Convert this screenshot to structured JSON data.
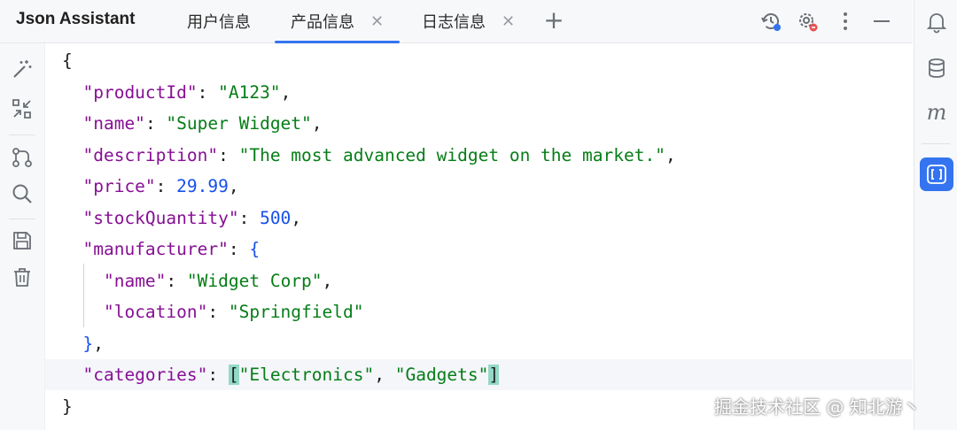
{
  "app": {
    "title": "Json Assistant"
  },
  "tabs": [
    {
      "label": "用户信息",
      "active": false,
      "closable": false
    },
    {
      "label": "产品信息",
      "active": true,
      "closable": true
    },
    {
      "label": "日志信息",
      "active": false,
      "closable": true
    }
  ],
  "toolbar": {
    "icons": [
      "history-settings-icon",
      "settings-reset-icon",
      "more-vert-icon",
      "minimize-icon"
    ]
  },
  "left_tools": [
    "magic-wand-icon",
    "collapse-icon",
    "branch-icon",
    "search-icon",
    "save-icon",
    "trash-icon"
  ],
  "right_tools": [
    "bell-icon",
    "database-icon",
    "m-icon",
    "json-panel-icon"
  ],
  "editor": {
    "lines": [
      [
        {
          "t": "{",
          "c": "p"
        }
      ],
      [
        {
          "t": "  ",
          "c": "p"
        },
        {
          "t": "\"productId\"",
          "c": "k"
        },
        {
          "t": ": ",
          "c": "p"
        },
        {
          "t": "\"A123\"",
          "c": "s"
        },
        {
          "t": ",",
          "c": "p"
        }
      ],
      [
        {
          "t": "  ",
          "c": "p"
        },
        {
          "t": "\"name\"",
          "c": "k"
        },
        {
          "t": ": ",
          "c": "p"
        },
        {
          "t": "\"Super Widget\"",
          "c": "s"
        },
        {
          "t": ",",
          "c": "p"
        }
      ],
      [
        {
          "t": "  ",
          "c": "p"
        },
        {
          "t": "\"description\"",
          "c": "k"
        },
        {
          "t": ": ",
          "c": "p"
        },
        {
          "t": "\"The most advanced widget on the market.\"",
          "c": "s"
        },
        {
          "t": ",",
          "c": "p"
        }
      ],
      [
        {
          "t": "  ",
          "c": "p"
        },
        {
          "t": "\"price\"",
          "c": "k"
        },
        {
          "t": ": ",
          "c": "p"
        },
        {
          "t": "29.99",
          "c": "n"
        },
        {
          "t": ",",
          "c": "p"
        }
      ],
      [
        {
          "t": "  ",
          "c": "p"
        },
        {
          "t": "\"stockQuantity\"",
          "c": "k"
        },
        {
          "t": ": ",
          "c": "p"
        },
        {
          "t": "500",
          "c": "n"
        },
        {
          "t": ",",
          "c": "p"
        }
      ],
      [
        {
          "t": "  ",
          "c": "p"
        },
        {
          "t": "\"manufacturer\"",
          "c": "k"
        },
        {
          "t": ": ",
          "c": "p"
        },
        {
          "t": "{",
          "c": "n"
        }
      ],
      [
        {
          "t": "    ",
          "c": "p"
        },
        {
          "t": "\"name\"",
          "c": "k"
        },
        {
          "t": ": ",
          "c": "p"
        },
        {
          "t": "\"Widget Corp\"",
          "c": "s"
        },
        {
          "t": ",",
          "c": "p"
        }
      ],
      [
        {
          "t": "    ",
          "c": "p"
        },
        {
          "t": "\"location\"",
          "c": "k"
        },
        {
          "t": ": ",
          "c": "p"
        },
        {
          "t": "\"Springfield\"",
          "c": "s"
        }
      ],
      [
        {
          "t": "  ",
          "c": "p"
        },
        {
          "t": "}",
          "c": "n"
        },
        {
          "t": ",",
          "c": "p"
        }
      ],
      [
        {
          "t": "  ",
          "c": "p"
        },
        {
          "t": "\"categories\"",
          "c": "k"
        },
        {
          "t": ": ",
          "c": "p"
        },
        {
          "t": "[",
          "c": "p brm"
        },
        {
          "t": "\"Electronics\"",
          "c": "s"
        },
        {
          "t": ", ",
          "c": "p"
        },
        {
          "t": "\"Gadgets\"",
          "c": "s"
        },
        {
          "t": "]",
          "c": "p brm"
        }
      ],
      [
        {
          "t": "}",
          "c": "p"
        }
      ]
    ],
    "highlighted_line": 10
  },
  "watermark": "掘金技术社区 @ 知北游丶",
  "colors": {
    "accent": "#3574f0",
    "key": "#871094",
    "string": "#067d17",
    "number": "#1750eb"
  }
}
